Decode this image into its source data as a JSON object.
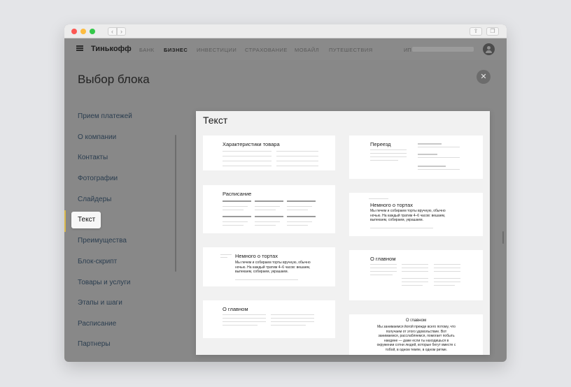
{
  "header": {
    "logo": "Тинькофф",
    "nav": [
      "БАНК",
      "БИЗНЕС",
      "ИНВЕСТИЦИИ",
      "СТРАХОВАНИЕ",
      "МОБАЙЛ",
      "ПУТЕШЕСТВИЯ"
    ],
    "active_nav": "БИЗНЕС",
    "user_prefix": "ИП"
  },
  "modal": {
    "title": "Выбор блока",
    "close_icon": "close-icon"
  },
  "categories": [
    "Прием платежей",
    "О компании",
    "Контакты",
    "Фотографии",
    "Слайдеры",
    "Текст",
    "Преимущества",
    "Блок-скрипт",
    "Товары и услуги",
    "Этапы и шаги",
    "Расписание",
    "Партнеры"
  ],
  "selected_category": "Текст",
  "panel": {
    "title": "Текст",
    "cards": {
      "characteristics": "Характеристики товара",
      "schedule": "Расписание",
      "about_cakes_left": "Немного о тортах",
      "about_cakes_left_text": "Мы печем и собираем торты вручную, обычно ночью. На каждый тратим 4–6 часов: вешаем, выпекаем, собираем, украшаем.",
      "about_main_left": "О главном",
      "moving": "Переезд",
      "about_cakes_right": "Немного о тортах",
      "about_cakes_right_text": "Мы печем и собираем торты вручную, обычно ночью. На каждый тратим 4–6 часов: вешаем, выпекаем, собираем, украшаем.",
      "about_main_right": "О главном",
      "about_main_center": "О главном",
      "about_main_center_text": "Мы занимаемся йогой прежде всего потому, что получаем от этого удовольствие. Вот занимаемся, расслабляемся, помогает побыть наедине — даже если ты находишься в окружении сотни людей, которые бегут вместе с тобой, в одном темпе, в одном ритме."
    }
  }
}
